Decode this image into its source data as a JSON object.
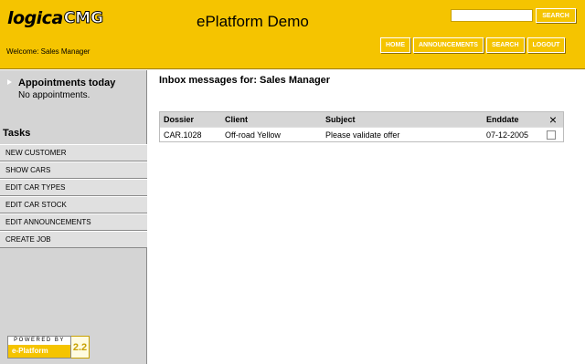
{
  "header": {
    "logo_part1": "logica",
    "logo_part2": "CMG",
    "title": "ePlatform Demo",
    "welcome": "Welcome: Sales Manager",
    "search_value": "",
    "search_button": "SEARCH",
    "nav": [
      "HOME",
      "ANNOUNCEMENTS",
      "SEARCH",
      "LOGOUT"
    ]
  },
  "sidebar": {
    "appointments_title": "Appointments today",
    "appointments_text": "No appointments.",
    "tasks_title": "Tasks",
    "tasks": [
      "NEW CUSTOMER",
      "SHOW CARS",
      "EDIT CAR TYPES",
      "EDIT CAR STOCK",
      "EDIT ANNOUNCEMENTS",
      "CREATE JOB"
    ],
    "powered_by": "POWERED BY",
    "powered_brand": "e-Platform",
    "powered_version": "2.2"
  },
  "main": {
    "title": "Inbox messages for: Sales Manager",
    "columns": [
      "Dossier",
      "Client",
      "Subject",
      "Enddate",
      "×"
    ],
    "rows": [
      {
        "dossier": "CAR.1028",
        "client": "Off-road Yellow",
        "subject": "Please validate offer",
        "enddate": "07-12-2005",
        "checked": false
      }
    ]
  },
  "colors": {
    "brand_yellow": "#f5c400",
    "sidebar_gray": "#d4d4d4",
    "table_header": "#d6d6d6"
  }
}
